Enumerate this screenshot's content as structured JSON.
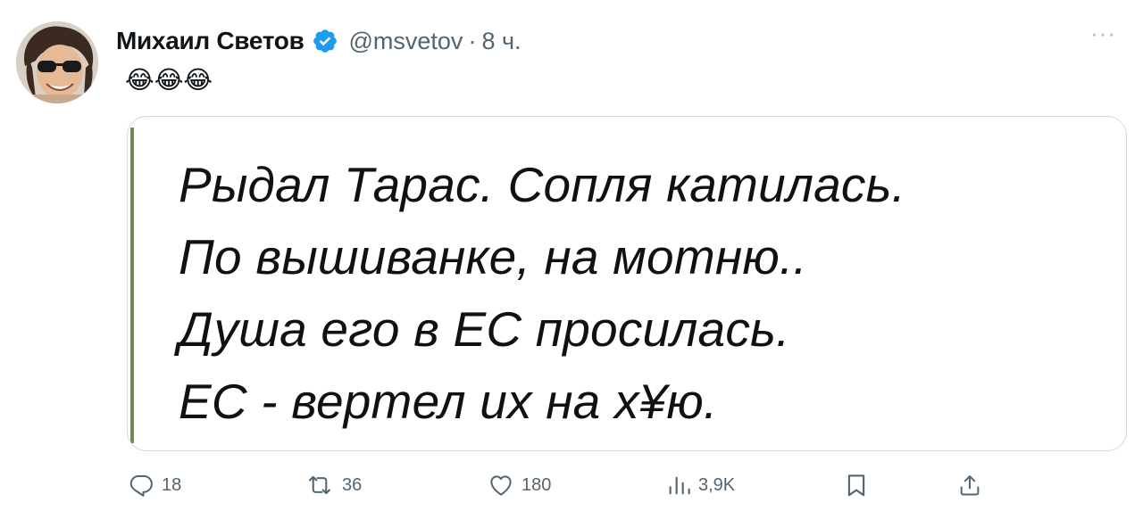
{
  "author": {
    "display_name": "Михаил Светов",
    "handle": "@msvetov",
    "separator": "·",
    "time": "8 ч."
  },
  "tweet": {
    "text": "😂😂😂",
    "more_label": "···"
  },
  "media": {
    "lines": [
      "Рыдал Тарас. Сопля катилась.",
      "По вышиванке, на мотню..",
      "Душа его в ЕС просилась.",
      "ЕС - вертел их на х¥ю."
    ]
  },
  "actions": {
    "replies": "18",
    "retweets": "36",
    "likes": "180",
    "views": "3,9K"
  },
  "colors": {
    "verified": "#1d9bf0",
    "muted": "#536471",
    "border": "#cfd9de"
  },
  "icons": [
    "verified-badge-icon",
    "reply-icon",
    "retweet-icon",
    "like-icon",
    "views-icon",
    "bookmark-icon",
    "share-icon",
    "more-icon"
  ]
}
